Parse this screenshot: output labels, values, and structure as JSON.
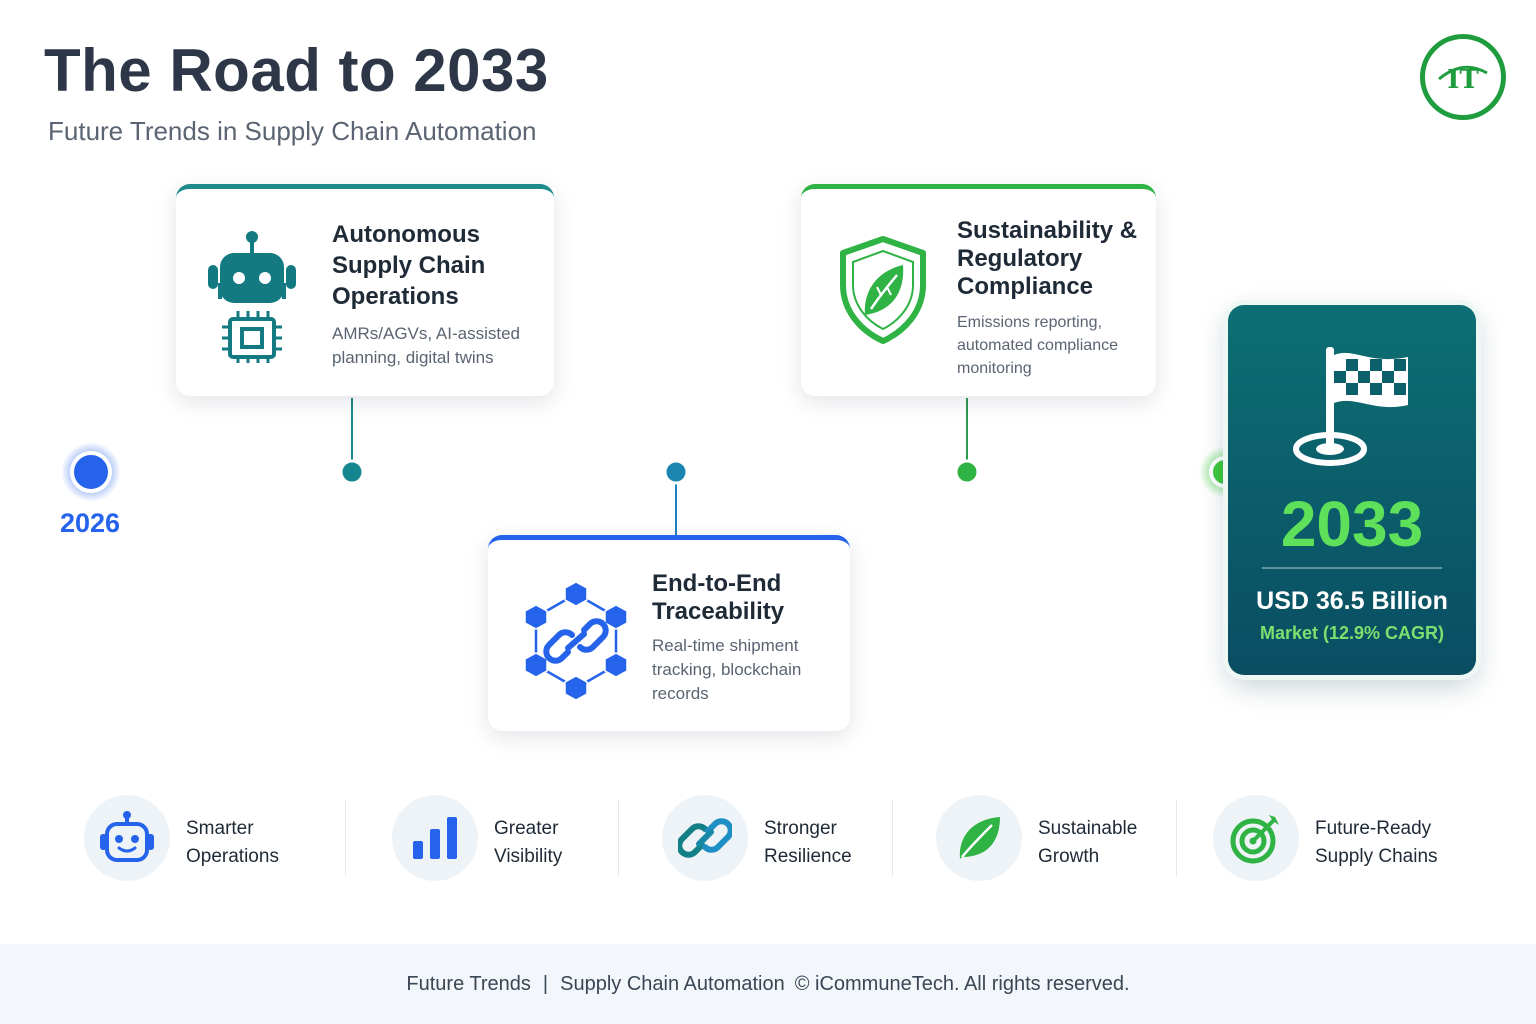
{
  "header": {
    "title": "The Road to 2033",
    "subtitle": "Future Trends in Supply Chain Automation",
    "logo_text": "IT"
  },
  "timeline": {
    "start_year": "2026",
    "milestones": [
      {
        "title_lines": [
          "Autonomous",
          "Supply Chain",
          "Operations"
        ],
        "description_lines": [
          "AMRs/AGVs, AI-assisted",
          "planning, digital twins"
        ],
        "icon": "robot-chip-icon",
        "accent": "#1f8a8a"
      },
      {
        "title_lines": [
          "End-to-End",
          "Traceability"
        ],
        "description_lines": [
          "Real-time shipment",
          "tracking, blockchain",
          "records"
        ],
        "icon": "blockchain-link-icon",
        "accent": "#2563eb"
      },
      {
        "title_lines": [
          "Sustainability &",
          "Regulatory",
          "Compliance"
        ],
        "description_lines": [
          "Emissions reporting,",
          "automated compliance",
          "monitoring"
        ],
        "icon": "shield-leaf-icon",
        "accent": "#2fb344"
      }
    ],
    "goal": {
      "year": "2033",
      "value": "USD 36.5 Billion",
      "subtext": "Market (12.9% CAGR)",
      "icon": "checkered-flag-icon"
    }
  },
  "benefits": [
    {
      "lines": [
        "Smarter",
        "Operations"
      ],
      "icon": "robot-face-icon"
    },
    {
      "lines": [
        "Greater",
        "Visibility"
      ],
      "icon": "bar-chart-icon"
    },
    {
      "lines": [
        "Stronger",
        "Resilience"
      ],
      "icon": "chain-link-icon"
    },
    {
      "lines": [
        "Sustainable",
        "Growth"
      ],
      "icon": "leaf-icon"
    },
    {
      "lines": [
        "Future-Ready",
        "Supply Chains"
      ],
      "icon": "target-icon"
    }
  ],
  "footer": {
    "part1": "Future Trends",
    "part2": "Supply Chain Automation",
    "part3": "© iCommuneTech. All rights reserved."
  },
  "colors": {
    "blue": "#2563eb",
    "teal": "#1f8a8a",
    "green": "#2fb344",
    "dark_teal": "#0a4d62",
    "bright_green": "#5fe05a"
  }
}
